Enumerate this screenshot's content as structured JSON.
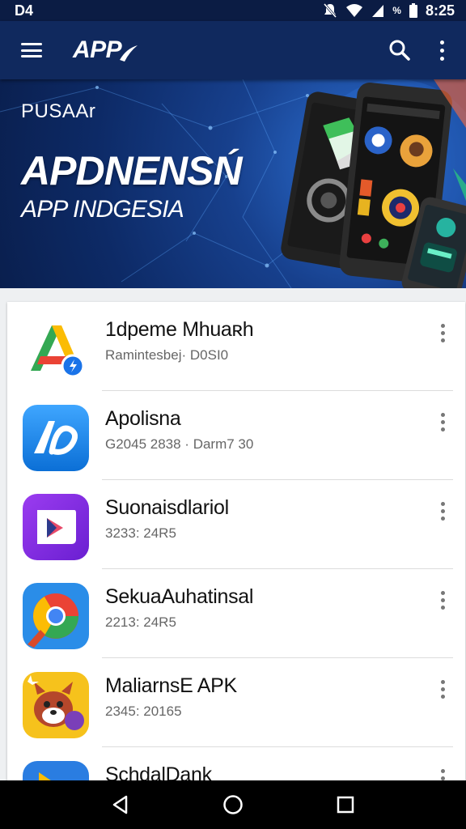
{
  "status_bar": {
    "left_text": "D4",
    "time": "8:25",
    "battery_text": "%",
    "icons": [
      "notification-icon",
      "mute-icon",
      "wifi-icon",
      "signal-icon",
      "battery-icon"
    ]
  },
  "app_bar": {
    "title": "APP",
    "icons": [
      "menu-icon",
      "search-icon",
      "more-vert-icon"
    ]
  },
  "banner": {
    "kicker": "PUSAAr",
    "title": "APDNENSŃ",
    "subtitle": "APP INDGESIA"
  },
  "apps": [
    {
      "name": "1dpeme Mhuaʀh",
      "meta": "Ramintesbej· D0SI0",
      "icon": "green-a-icon"
    },
    {
      "name": "Apolisna",
      "meta": "G2045  2838 · Darm7 30",
      "icon": "blue-ab-icon"
    },
    {
      "name": "Suonaisdlariol",
      "meta": "3233: 24R5",
      "icon": "purple-play-icon"
    },
    {
      "name": "SekuaAuhatinsal",
      "meta": "2213: 24R5",
      "icon": "chrome-icon"
    },
    {
      "name": "MaliarnsE APK",
      "meta": "2345: 20165",
      "icon": "fox-mascot-icon"
    },
    {
      "name": "SchdalDank",
      "meta": "",
      "icon": "play-store-icon"
    }
  ],
  "nav_bar": {
    "icons": [
      "back-icon",
      "home-icon",
      "recents-icon"
    ]
  },
  "colors": {
    "status_bar": "#0b1c44",
    "app_bar": "#10295e",
    "banner_bg": "#0d2a66",
    "nav_bar": "#000000"
  }
}
